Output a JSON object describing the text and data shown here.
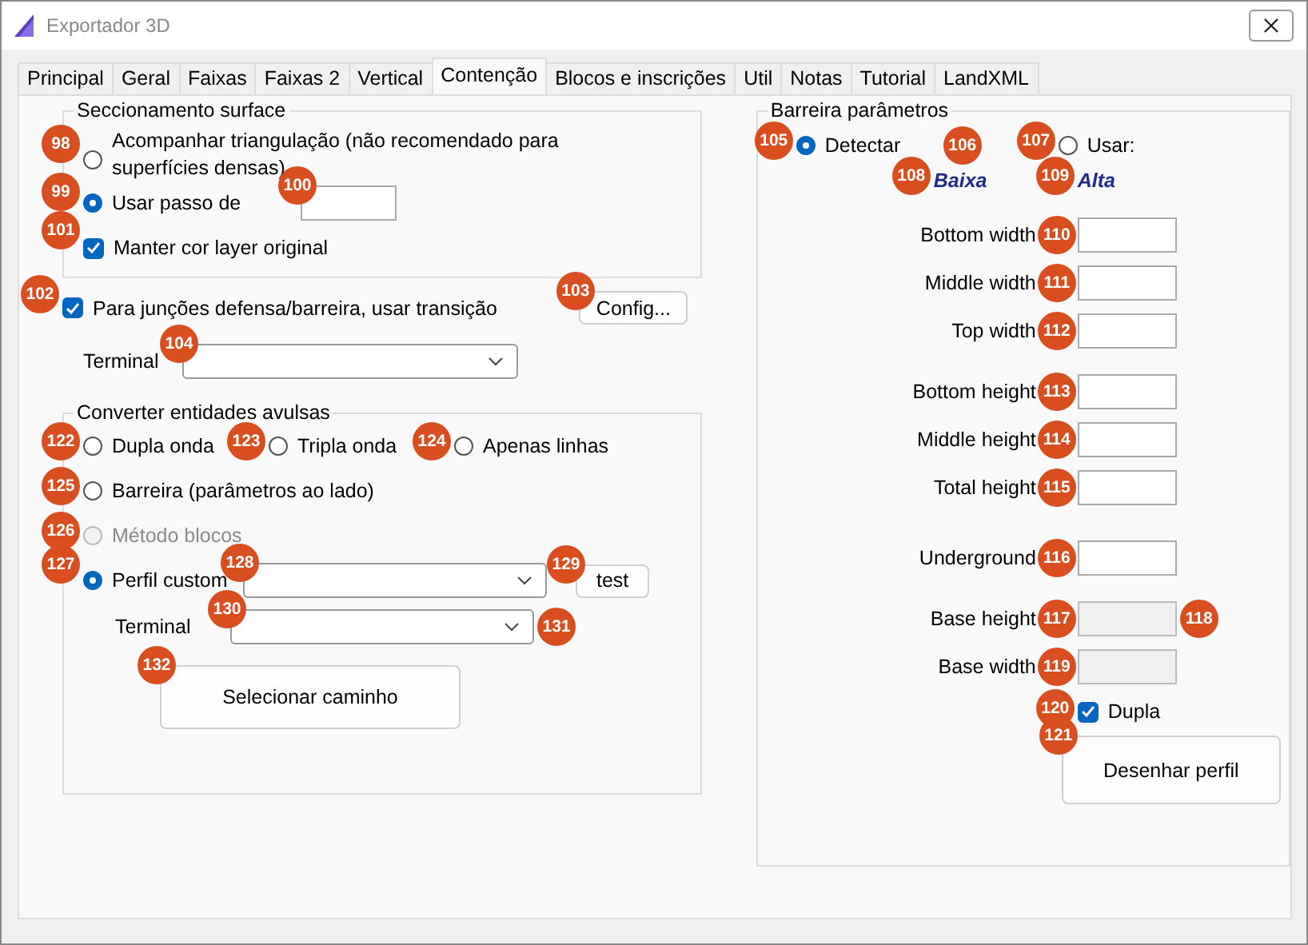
{
  "window": {
    "title": "Exportador 3D"
  },
  "tabs": [
    {
      "label": "Principal",
      "selected": false
    },
    {
      "label": "Geral",
      "selected": false
    },
    {
      "label": "Faixas",
      "selected": false
    },
    {
      "label": "Faixas 2",
      "selected": false
    },
    {
      "label": "Vertical",
      "selected": false
    },
    {
      "label": "Contenção",
      "selected": true
    },
    {
      "label": "Blocos e inscrições",
      "selected": false
    },
    {
      "label": "Util",
      "selected": false
    },
    {
      "label": "Notas",
      "selected": false
    },
    {
      "label": "Tutorial",
      "selected": false
    },
    {
      "label": "LandXML",
      "selected": false
    }
  ],
  "surface_section": {
    "title": "Seccionamento surface",
    "options": [
      {
        "label": "Acompanhar triangulação (não recomendado para superfícies densas)",
        "selected": false,
        "badge": "98"
      },
      {
        "label": "Usar passo de",
        "selected": true,
        "badge": "99",
        "field_badge": "100"
      }
    ],
    "keep_color": {
      "label": "Manter cor layer original",
      "checked": true,
      "badge": "101"
    }
  },
  "transition": {
    "label": "Para junções defensa/barreira, usar transição",
    "checked": true,
    "badge": "102",
    "button": "Config...",
    "button_badge": "103",
    "terminal_label": "Terminal",
    "terminal_badge": "104"
  },
  "convert_section": {
    "title": "Converter entidades avulsas",
    "radio_rows": [
      [
        {
          "label": "Dupla onda",
          "selected": false,
          "disabled": false,
          "badge": "122"
        },
        {
          "label": "Tripla onda",
          "selected": false,
          "disabled": false,
          "badge": "123"
        },
        {
          "label": "Apenas linhas",
          "selected": false,
          "disabled": false,
          "badge": "124"
        }
      ],
      [
        {
          "label": "Barreira (parâmetros ao lado)",
          "selected": false,
          "disabled": false,
          "badge": "125"
        }
      ],
      [
        {
          "label": "Método blocos",
          "selected": false,
          "disabled": true,
          "badge": "126"
        }
      ]
    ],
    "custom": {
      "label": "Perfil custom",
      "selected": true,
      "badge": "127",
      "dropdown_badge": "128",
      "button": "test",
      "button_badge": "129"
    },
    "terminal": {
      "label": "Terminal",
      "badge": "130",
      "after_badge": "131"
    },
    "path_button": {
      "label": "Selecionar caminho",
      "badge": "132"
    }
  },
  "barrier_section": {
    "title": "Barreira parâmetros",
    "modes": [
      {
        "label": "Detectar",
        "selected": true,
        "badge": "105"
      },
      {
        "label": "Usar:",
        "selected": false,
        "badge": "107"
      }
    ],
    "mode_badge": "106",
    "presets": [
      {
        "label": "Baixa",
        "badge": "108"
      },
      {
        "label": "Alta",
        "badge": "109"
      }
    ],
    "field_groups": [
      [
        {
          "label": "Bottom width",
          "badge": "110",
          "disabled": false
        },
        {
          "label": "Middle width",
          "badge": "111",
          "disabled": false
        },
        {
          "label": "Top width",
          "badge": "112",
          "disabled": false
        }
      ],
      [
        {
          "label": "Bottom height",
          "badge": "113",
          "disabled": false
        },
        {
          "label": "Middle height",
          "badge": "114",
          "disabled": false
        },
        {
          "label": "Total height",
          "badge": "115",
          "disabled": false
        }
      ],
      [
        {
          "label": "Underground",
          "badge": "116",
          "disabled": false
        }
      ],
      [
        {
          "label": "Base height",
          "badge": "117",
          "disabled": true,
          "after_badge": "118"
        },
        {
          "label": "Base width",
          "badge": "119",
          "disabled": true
        }
      ]
    ],
    "double": {
      "label": "Dupla",
      "checked": true,
      "badge": "120"
    },
    "draw_button": {
      "label": "Desenhar perfil",
      "badge": "121"
    }
  }
}
